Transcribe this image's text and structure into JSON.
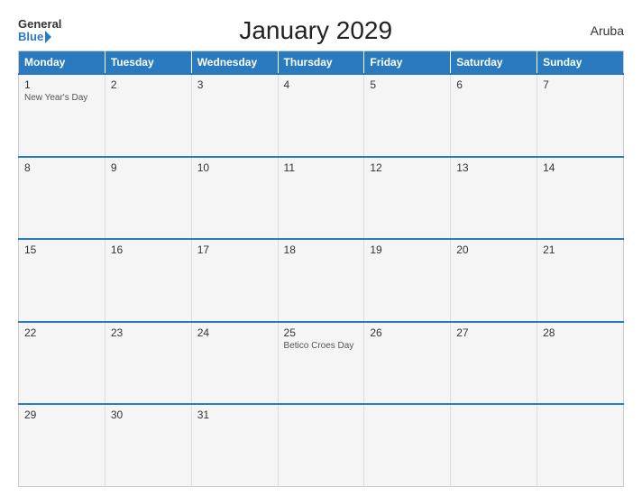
{
  "header": {
    "logo_general": "General",
    "logo_blue": "Blue",
    "title": "January 2029",
    "country": "Aruba"
  },
  "calendar": {
    "columns": [
      "Monday",
      "Tuesday",
      "Wednesday",
      "Thursday",
      "Friday",
      "Saturday",
      "Sunday"
    ],
    "weeks": [
      [
        {
          "day": "1",
          "holiday": "New Year's Day"
        },
        {
          "day": "2",
          "holiday": ""
        },
        {
          "day": "3",
          "holiday": ""
        },
        {
          "day": "4",
          "holiday": ""
        },
        {
          "day": "5",
          "holiday": ""
        },
        {
          "day": "6",
          "holiday": ""
        },
        {
          "day": "7",
          "holiday": ""
        }
      ],
      [
        {
          "day": "8",
          "holiday": ""
        },
        {
          "day": "9",
          "holiday": ""
        },
        {
          "day": "10",
          "holiday": ""
        },
        {
          "day": "11",
          "holiday": ""
        },
        {
          "day": "12",
          "holiday": ""
        },
        {
          "day": "13",
          "holiday": ""
        },
        {
          "day": "14",
          "holiday": ""
        }
      ],
      [
        {
          "day": "15",
          "holiday": ""
        },
        {
          "day": "16",
          "holiday": ""
        },
        {
          "day": "17",
          "holiday": ""
        },
        {
          "day": "18",
          "holiday": ""
        },
        {
          "day": "19",
          "holiday": ""
        },
        {
          "day": "20",
          "holiday": ""
        },
        {
          "day": "21",
          "holiday": ""
        }
      ],
      [
        {
          "day": "22",
          "holiday": ""
        },
        {
          "day": "23",
          "holiday": ""
        },
        {
          "day": "24",
          "holiday": ""
        },
        {
          "day": "25",
          "holiday": "Betico Croes Day"
        },
        {
          "day": "26",
          "holiday": ""
        },
        {
          "day": "27",
          "holiday": ""
        },
        {
          "day": "28",
          "holiday": ""
        }
      ],
      [
        {
          "day": "29",
          "holiday": ""
        },
        {
          "day": "30",
          "holiday": ""
        },
        {
          "day": "31",
          "holiday": ""
        },
        {
          "day": "",
          "holiday": ""
        },
        {
          "day": "",
          "holiday": ""
        },
        {
          "day": "",
          "holiday": ""
        },
        {
          "day": "",
          "holiday": ""
        }
      ]
    ]
  }
}
